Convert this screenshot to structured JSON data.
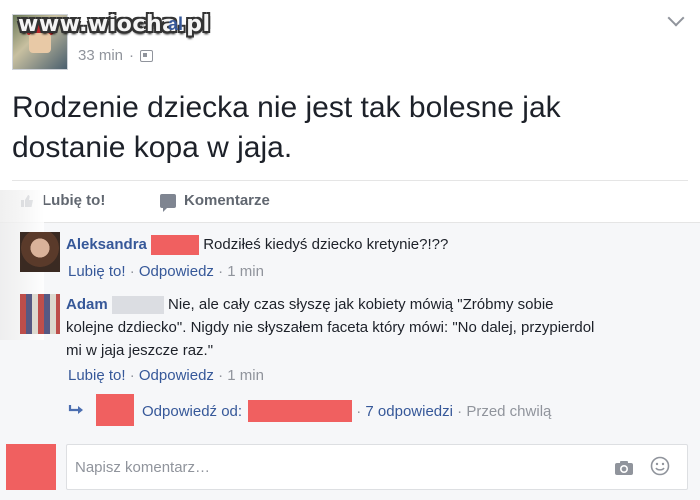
{
  "watermark": "www.wiocha.pl",
  "post": {
    "author_tail": "al",
    "time": "33 min",
    "text": "Rodzenie dziecka nie jest tak bolesne jak dostanie kopa w jaja."
  },
  "actions": {
    "like": "Lubię to!",
    "comment": "Komentarze"
  },
  "comments": [
    {
      "author": "Aleksandra",
      "text": "Rodziłeś kiedyś dziecko kretynie?!??",
      "like": "Lubię to!",
      "reply": "Odpowiedz",
      "time": "1 min"
    },
    {
      "author": "Adam",
      "text_lines": [
        "Nie, ale cały czas słyszę jak kobiety mówią \"Zróbmy sobie",
        "kolejne dzdiecko\". Nigdy nie słyszałem faceta który mówi: \"No dalej, przypierdol",
        "mi w jaja jeszcze raz.\""
      ],
      "like": "Lubię to!",
      "reply": "Odpowiedz",
      "time": "1 min"
    }
  ],
  "replies": {
    "label": "Odpowiedź od:",
    "count": "7 odpowiedzi",
    "time": "Przed chwilą"
  },
  "composer": {
    "placeholder": "Napisz komentarz…"
  },
  "colors": {
    "link": "#365899",
    "muted": "#90949c",
    "redaction": "#f06060"
  },
  "icons": [
    "chevron-down-icon",
    "privacy-icon",
    "like-icon",
    "comment-icon",
    "reply-arrow-icon",
    "camera-icon",
    "emoji-icon"
  ]
}
